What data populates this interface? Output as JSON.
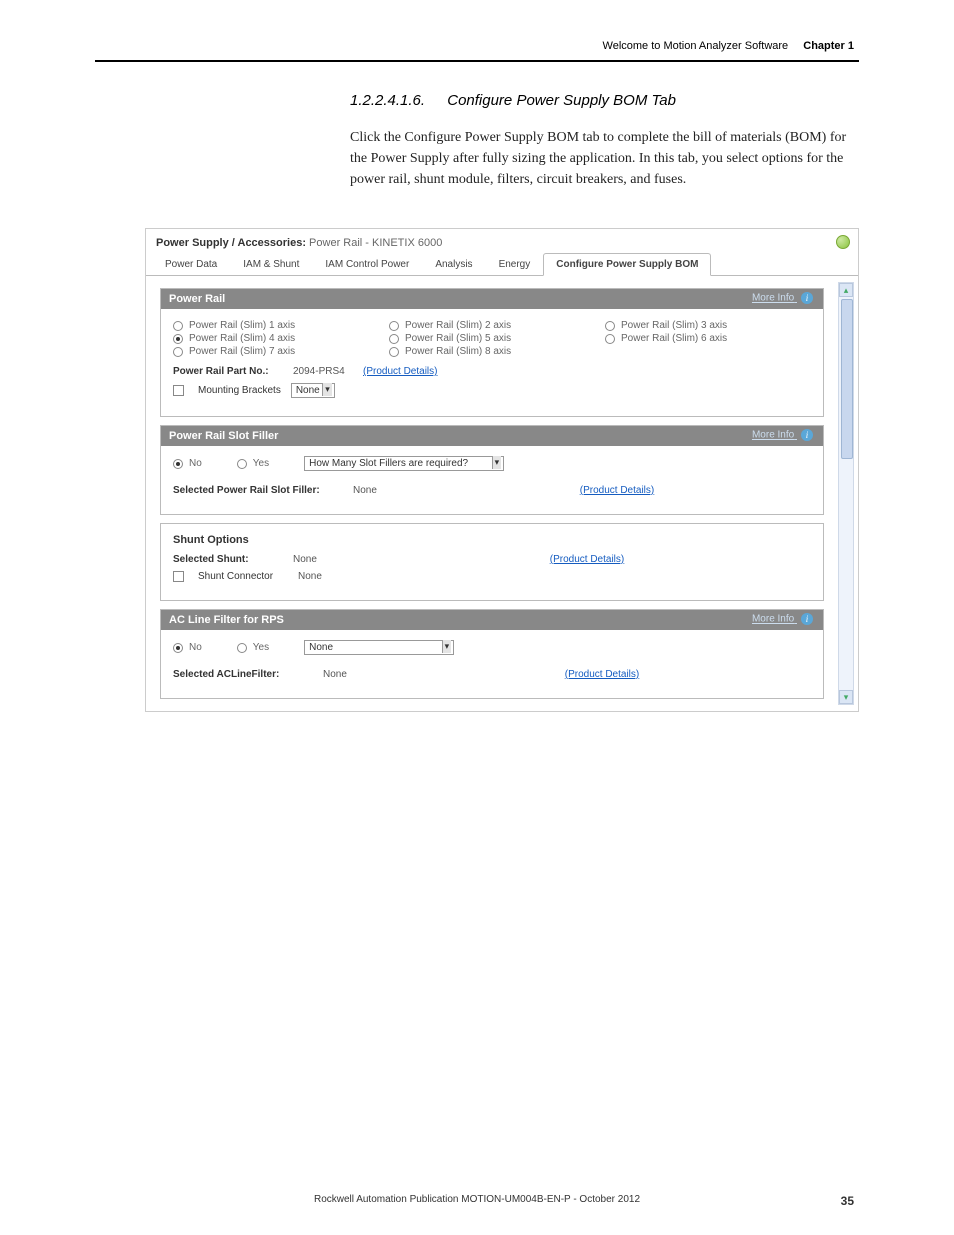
{
  "header": {
    "section_title": "Welcome to Motion Analyzer Software",
    "chapter": "Chapter 1"
  },
  "body": {
    "heading_number": "1.2.2.4.1.6.",
    "heading_text": "Configure Power Supply BOM Tab",
    "paragraph": "Click the Configure Power Supply BOM tab to complete the bill of materials (BOM) for the Power Supply after fully sizing the application. In this tab, you select options for the power rail, shunt module, filters, circuit breakers, and fuses."
  },
  "shot": {
    "title_label": "Power Supply / Accessories:",
    "title_value": "Power Rail - KINETIX 6000",
    "tabs": [
      "Power Data",
      "IAM & Shunt",
      "IAM Control Power",
      "Analysis",
      "Energy",
      "Configure Power Supply BOM"
    ],
    "active_tab": 5,
    "more_info": "More Info",
    "power_rail": {
      "title": "Power Rail",
      "options_col1": [
        "Power Rail (Slim) 1 axis",
        "Power Rail (Slim) 4 axis",
        "Power Rail (Slim) 7 axis"
      ],
      "options_col2": [
        "Power Rail (Slim) 2 axis",
        "Power Rail (Slim) 5 axis",
        "Power Rail (Slim) 8 axis"
      ],
      "options_col3": [
        "Power Rail (Slim) 3 axis",
        "Power Rail (Slim) 6 axis"
      ],
      "selected": "Power Rail (Slim) 4 axis",
      "partno_label": "Power Rail Part No.:",
      "partno_value": "2094-PRS4",
      "product_details": "(Product Details)",
      "mounting_label": "Mounting Brackets",
      "mounting_value": "None"
    },
    "slot_filler": {
      "title": "Power Rail Slot Filler",
      "no": "No",
      "yes": "Yes",
      "q_label": "How Many Slot Fillers are required?",
      "q_value": "",
      "selected_label": "Selected Power Rail Slot Filler:",
      "selected_value": "None",
      "product_details": "(Product Details)"
    },
    "shunt": {
      "title": "Shunt Options",
      "selected_label": "Selected Shunt:",
      "selected_value": "None",
      "product_details": "(Product Details)",
      "connector_label": "Shunt Connector",
      "connector_value": "None"
    },
    "acfilter": {
      "title": "AC Line Filter for RPS",
      "no": "No",
      "yes": "Yes",
      "select_value": "None",
      "selected_label": "Selected ACLineFilter:",
      "selected_value": "None",
      "product_details": "(Product Details)"
    }
  },
  "footer": {
    "text": "Rockwell Automation Publication MOTION-UM004B-EN-P - October 2012",
    "page": "35"
  }
}
